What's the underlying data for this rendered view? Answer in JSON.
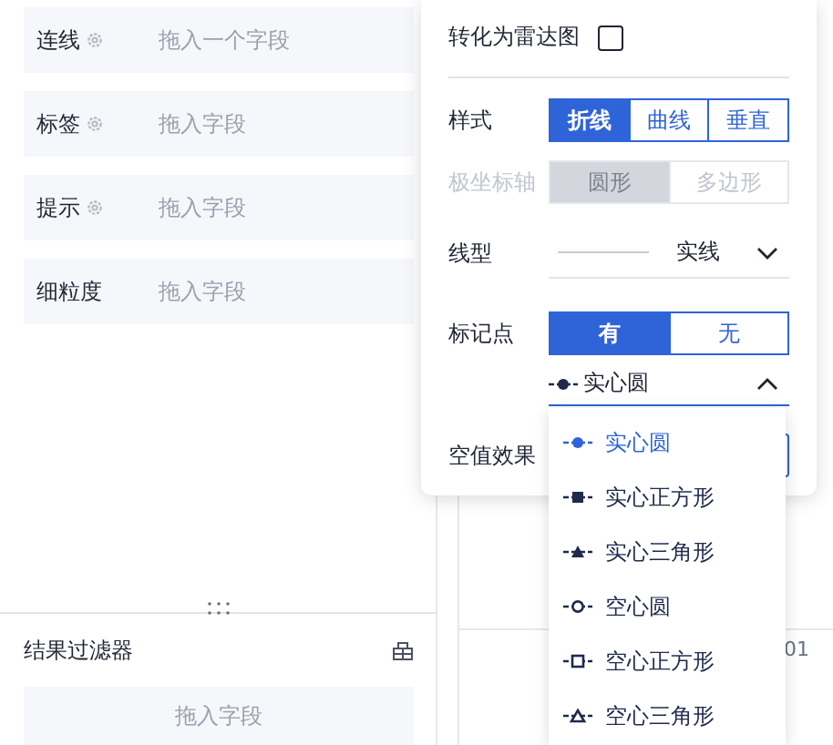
{
  "fields": [
    {
      "label": "连线",
      "has_settings": true,
      "placeholder": "拖入一个字段"
    },
    {
      "label": "标签",
      "has_settings": true,
      "placeholder": "拖入字段"
    },
    {
      "label": "提示",
      "has_settings": true,
      "placeholder": "拖入字段"
    },
    {
      "label": "细粒度",
      "has_settings": false,
      "placeholder": "拖入字段"
    }
  ],
  "filter": {
    "title": "结果过滤器",
    "placeholder": "拖入字段"
  },
  "chart_background": {
    "axis_label": "01"
  },
  "popover": {
    "radar": {
      "label": "转化为雷达图",
      "checked": false
    },
    "style": {
      "label": "样式",
      "options": [
        {
          "label": "折线",
          "selected": true
        },
        {
          "label": "曲线",
          "selected": false
        },
        {
          "label": "垂直",
          "selected": false
        }
      ]
    },
    "polar": {
      "label": "极坐标轴",
      "disabled": true,
      "options": [
        {
          "label": "圆形",
          "selected": true
        },
        {
          "label": "多边形",
          "selected": false
        }
      ]
    },
    "line_type": {
      "label": "线型",
      "value": "实线"
    },
    "marker": {
      "label": "标记点",
      "options": [
        {
          "label": "有",
          "selected": true
        },
        {
          "label": "无",
          "selected": false
        }
      ]
    },
    "marker_shape": {
      "value": "实心圆",
      "kind": "solid-circle",
      "expanded": true,
      "options": [
        {
          "label": "实心圆",
          "kind": "solid-circle",
          "selected": true
        },
        {
          "label": "实心正方形",
          "kind": "solid-square",
          "selected": false
        },
        {
          "label": "实心三角形",
          "kind": "solid-triangle",
          "selected": false
        },
        {
          "label": "空心圆",
          "kind": "hollow-circle",
          "selected": false
        },
        {
          "label": "空心正方形",
          "kind": "hollow-square",
          "selected": false
        },
        {
          "label": "空心三角形",
          "kind": "hollow-triangle",
          "selected": false
        }
      ]
    },
    "null_effect": {
      "label": "空值效果"
    }
  }
}
